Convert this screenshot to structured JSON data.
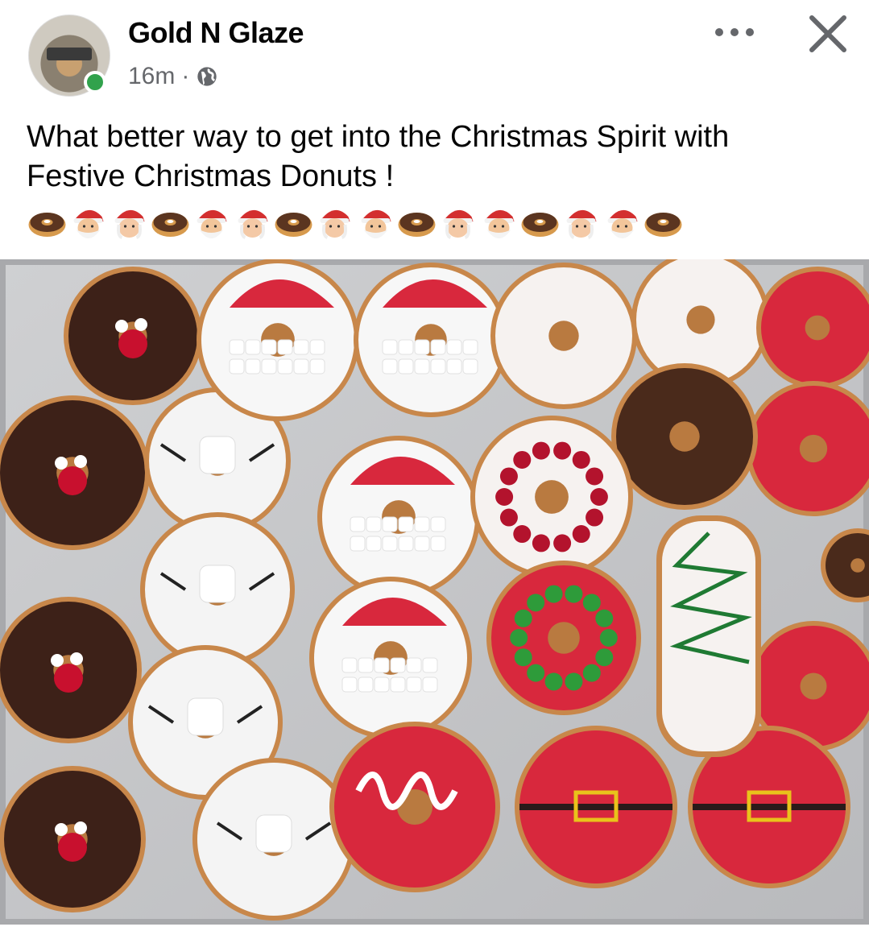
{
  "post": {
    "author": "Gold N Glaze",
    "time": "16m",
    "separator": "·",
    "privacy_icon": "globe-icon",
    "text_line1": "What better way to get into the Christmas Spirit with",
    "text_line2": "Festive Christmas Donuts !",
    "emoji_sequence": [
      "doughnut",
      "santa-man",
      "santa-woman",
      "doughnut",
      "santa-man",
      "santa-woman",
      "doughnut",
      "santa-woman",
      "santa-man",
      "doughnut",
      "santa-woman",
      "santa-man",
      "doughnut",
      "santa-woman",
      "santa-man",
      "doughnut"
    ]
  },
  "icons": {
    "more": "more-options-icon",
    "close": "close-icon",
    "online": "online-status-dot"
  },
  "colors": {
    "online_green": "#31a24c",
    "meta_gray": "#65676b",
    "text": "#050505"
  }
}
